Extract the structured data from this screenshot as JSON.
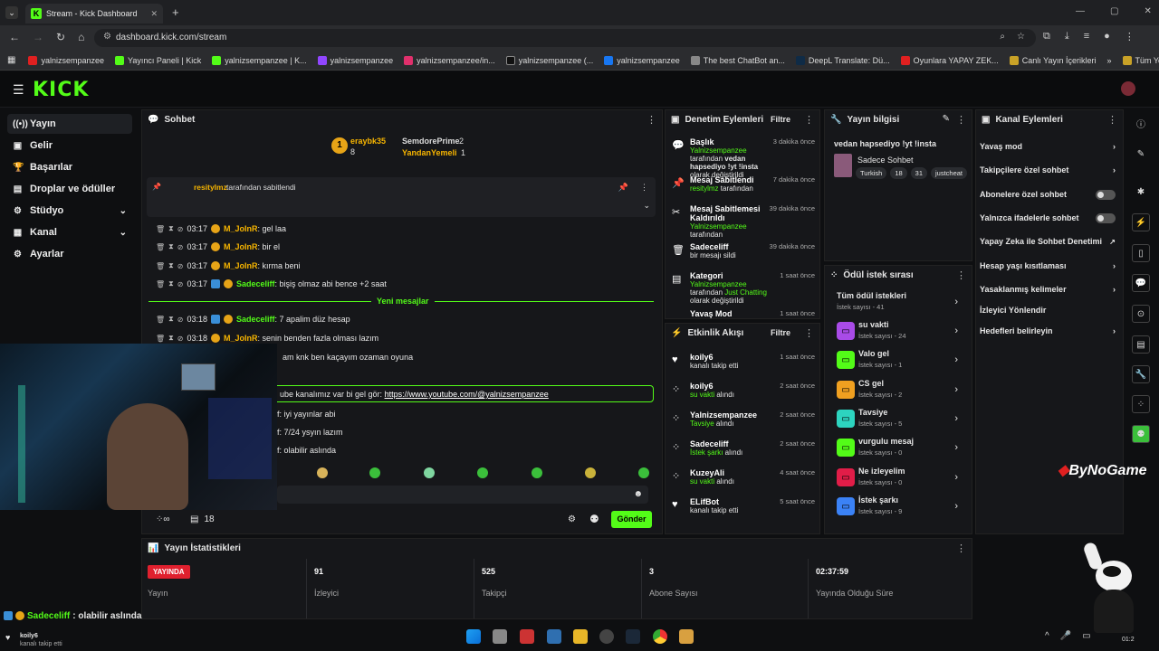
{
  "browser": {
    "tab_title": "Stream - Kick Dashboard",
    "url": "dashboard.kick.com/stream",
    "bookmarks": [
      "yalnizsempanzee",
      "Yayıncı Paneli | Kick",
      "yalnizsempanzee | K...",
      "yalnizsempanzee",
      "yalnizsempanzee/in...",
      "yalnizsempanzee (...",
      "yalnizsempanzee",
      "The best ChatBot an...",
      "DeepL Translate: Dü...",
      "Oyunlara YAPAY ZEK...",
      "Canlı Yayın İçerikleri"
    ],
    "bookmarks_more": "Tüm Yer İşaretleri"
  },
  "logo": "KICK",
  "sidebar": {
    "items": [
      {
        "label": "Yayın",
        "icon": "broadcast-icon"
      },
      {
        "label": "Gelir",
        "icon": "revenue-icon"
      },
      {
        "label": "Başarılar",
        "icon": "trophy-icon"
      },
      {
        "label": "Droplar ve ödüller",
        "icon": "gift-icon"
      },
      {
        "label": "Stüdyo",
        "icon": "studio-icon"
      },
      {
        "label": "Kanal",
        "icon": "channel-icon"
      },
      {
        "label": "Ayarlar",
        "icon": "gear-icon"
      }
    ]
  },
  "chat": {
    "title": "Sohbet",
    "top_gifters": [
      "eraybk35",
      "8",
      "SemdorePrime",
      "2",
      "YandanYemeli",
      "1"
    ],
    "pinned_by": "resitylmz",
    "pinned_suffix": "tarafından sabitlendi",
    "lines": [
      {
        "time": "03:17",
        "user": "M_JoInR",
        "text": ": gel laa",
        "color": "#f7b500"
      },
      {
        "time": "03:17",
        "user": "M_JoInR",
        "text": ": bir el",
        "color": "#f7b500"
      },
      {
        "time": "03:17",
        "user": "M_JoInR",
        "text": ": kırma beni",
        "color": "#f7b500"
      },
      {
        "time": "03:17",
        "user": "Sadeceliff",
        "text": ": bişiş olmaz abi bence +2 saat",
        "color": "#53fc18"
      }
    ],
    "new_messages": "Yeni mesajlar",
    "lines2": [
      {
        "time": "03:18",
        "user": "Sadeceliff",
        "text": ": 7 apalim düz hesap",
        "color": "#53fc18"
      },
      {
        "time": "03:18",
        "user": "M_JoInR",
        "text": ": senin benden fazla olması lazım",
        "color": "#f7b500"
      }
    ],
    "partial1": "am knk ben kaçayım ozaman oyuna",
    "highlight_prefix": "ube kanalımız var bi gel gör: ",
    "highlight_link": "https://www.youtube.com/@yalnizsempanzee",
    "partial2": "f: iyi yayınlar abi",
    "partial3": "f: 7/24 ysyın lazım",
    "partial4": "f: olabilir aslında",
    "viewer_count": "18",
    "send": "Gönder"
  },
  "moderation": {
    "title": "Denetim Eylemleri",
    "filter": "Filtre",
    "items": [
      {
        "title": "Başlık",
        "time": "3 dakika önce",
        "line1": "Yalnizsempanzee",
        "line1b": " tarafından ",
        "line2": "vedan hapsediyo !yt !insta",
        "line3": " olarak değiştirildi"
      },
      {
        "title": "Mesaj Sabitlendi",
        "time": "7 dakika önce",
        "line1": "resitylmz",
        "line1b": " tarafından"
      },
      {
        "title": "Mesaj Sabitlemesi Kaldırıldı",
        "time": "39 dakika önce",
        "line1": "Yalnizsempanzee",
        "line1b": " tarafından"
      },
      {
        "title": "Sadeceliff",
        "time": "39 dakika önce",
        "line1b": "bir mesajı sildi"
      },
      {
        "title": "Kategori",
        "time": "1 saat önce",
        "line1": "Yalnizsempanzee",
        "line1b": " tarafından ",
        "line2": "Just Chatting",
        "line3": " olarak değiştirildi"
      },
      {
        "title": "Yavaş Mod",
        "time": "1 saat önce"
      }
    ]
  },
  "activity": {
    "title": "Etkinlik Akışı",
    "filter": "Filtre",
    "items": [
      {
        "user": "koily6",
        "desc": "kanalı takip etti",
        "time": "1 saat önce",
        "green": ""
      },
      {
        "user": "koily6",
        "desc": " alındı",
        "time": "2 saat önce",
        "green": "su vakti"
      },
      {
        "user": "Yalnizsempanzee",
        "desc": " alındı",
        "time": "2 saat önce",
        "green": "Tavsiye"
      },
      {
        "user": "Sadeceliff",
        "desc": " alındı",
        "time": "2 saat önce",
        "green": "İstek şarkı"
      },
      {
        "user": "KuzeyAli",
        "desc": " alındı",
        "time": "4 saat önce",
        "green": "su vakti"
      },
      {
        "user": "ELifBot",
        "desc": "kanalı takip etti",
        "time": "5 saat önce",
        "green": ""
      }
    ]
  },
  "stream_info": {
    "title": "Yayın bilgisi",
    "stream_title": "vedan hapsediyo !yt !insta",
    "category": "Sadece Sohbet",
    "tags": [
      "Turkish",
      "18",
      "31",
      "justcheat"
    ]
  },
  "rewards": {
    "title": "Ödül istek sırası",
    "items": [
      {
        "name": "Tüm ödül istekleri",
        "sub": "İstek sayısı - 41",
        "color": ""
      },
      {
        "name": "su vakti",
        "sub": "İstek sayısı - 24",
        "color": "#a94be8"
      },
      {
        "name": "Valo gel",
        "sub": "İstek sayısı - 1",
        "color": "#53fc18"
      },
      {
        "name": "CS gel",
        "sub": "İstek sayısı - 2",
        "color": "#f0a020"
      },
      {
        "name": "Tavsiye",
        "sub": "İstek sayısı - 5",
        "color": "#2dd4bf"
      },
      {
        "name": "vurgulu mesaj",
        "sub": "İstek sayısı - 0",
        "color": "#53fc18"
      },
      {
        "name": "Ne izleyelim",
        "sub": "İstek sayısı - 0",
        "color": "#e11d48"
      },
      {
        "name": "İstek şarkı",
        "sub": "İstek sayısı - 9",
        "color": "#3b82f6"
      }
    ]
  },
  "channel_actions": {
    "title": "Kanal Eylemleri",
    "items": [
      {
        "label": "Yavaş mod",
        "type": "chevron"
      },
      {
        "label": "Takipçilere özel sohbet",
        "type": "chevron"
      },
      {
        "label": "Abonelere özel sohbet",
        "type": "toggle"
      },
      {
        "label": "Yalnızca ifadelerle sohbet",
        "type": "toggle"
      },
      {
        "label": "Yapay Zeka ile Sohbet Denetimi",
        "type": "external"
      },
      {
        "label": "Hesap yaşı kısıtlaması",
        "type": "chevron"
      },
      {
        "label": "Yasaklanmış kelimeler",
        "type": "chevron"
      },
      {
        "label": "İzleyici Yönlendir",
        "type": "none"
      },
      {
        "label": "Hedefleri belirleyin",
        "type": "chevron"
      }
    ]
  },
  "stats": {
    "title": "Yayın İstatistikleri",
    "live": "YAYINDA",
    "items": [
      {
        "value": "",
        "label": "Yayın"
      },
      {
        "value": "91",
        "label": "İzleyici"
      },
      {
        "value": "525",
        "label": "Takipçi"
      },
      {
        "value": "3",
        "label": "Abone Sayısı"
      },
      {
        "value": "02:37:59",
        "label": "Yayında Olduğu Süre"
      }
    ]
  },
  "overlay": {
    "watermark": "ByNoGame",
    "bottom_user": "Sadeceliff",
    "bottom_text": " : olabilir aslında",
    "follow_user": "koily6",
    "follow_text": "kanalı takip etti"
  },
  "taskbar": {
    "clock": "01:2"
  }
}
